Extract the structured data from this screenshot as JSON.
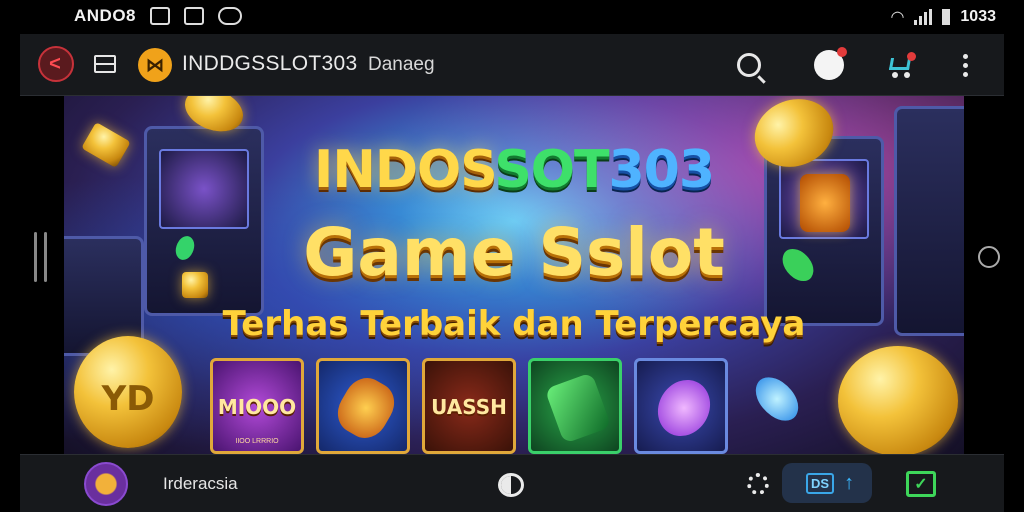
{
  "status_bar": {
    "carrier": "ANDO8",
    "time": "1033"
  },
  "app_bar": {
    "brand_name": "INDDGSSLOT303",
    "section": "Danaeg",
    "brand_logo_glyph": "⋈",
    "back_glyph": "<",
    "icons": [
      "back-icon",
      "menu-icon",
      "brand-logo-icon",
      "search-icon",
      "user-badge-icon",
      "cart-icon",
      "more-vert-icon"
    ]
  },
  "hero": {
    "title_part1": "INDOS",
    "title_part2": "SOT",
    "title_part3": "303",
    "headline": "Game Sslot",
    "tagline": "Terhas Terbaik dan Terpercaya",
    "tiles": [
      {
        "label": "MIOOO",
        "caption": "IIOO LRRRIO"
      },
      {
        "label": "",
        "caption": ""
      },
      {
        "label": "UASSH",
        "caption": ""
      },
      {
        "label": "",
        "caption": ""
      },
      {
        "label": "",
        "caption": ""
      }
    ],
    "coin_left_text": "YD",
    "colors": {
      "gold": "#ffd84a",
      "green": "#3ee06a",
      "blue": "#4fb3ff"
    }
  },
  "bottom_bar": {
    "label": "Irderacsia",
    "chip_text": "DS",
    "chip_arrow": "↑",
    "check_glyph": "✓",
    "icons": [
      "avatar",
      "toggle-icon",
      "gear-icon",
      "ds-chip",
      "upload-arrow-icon",
      "check-icon"
    ]
  }
}
